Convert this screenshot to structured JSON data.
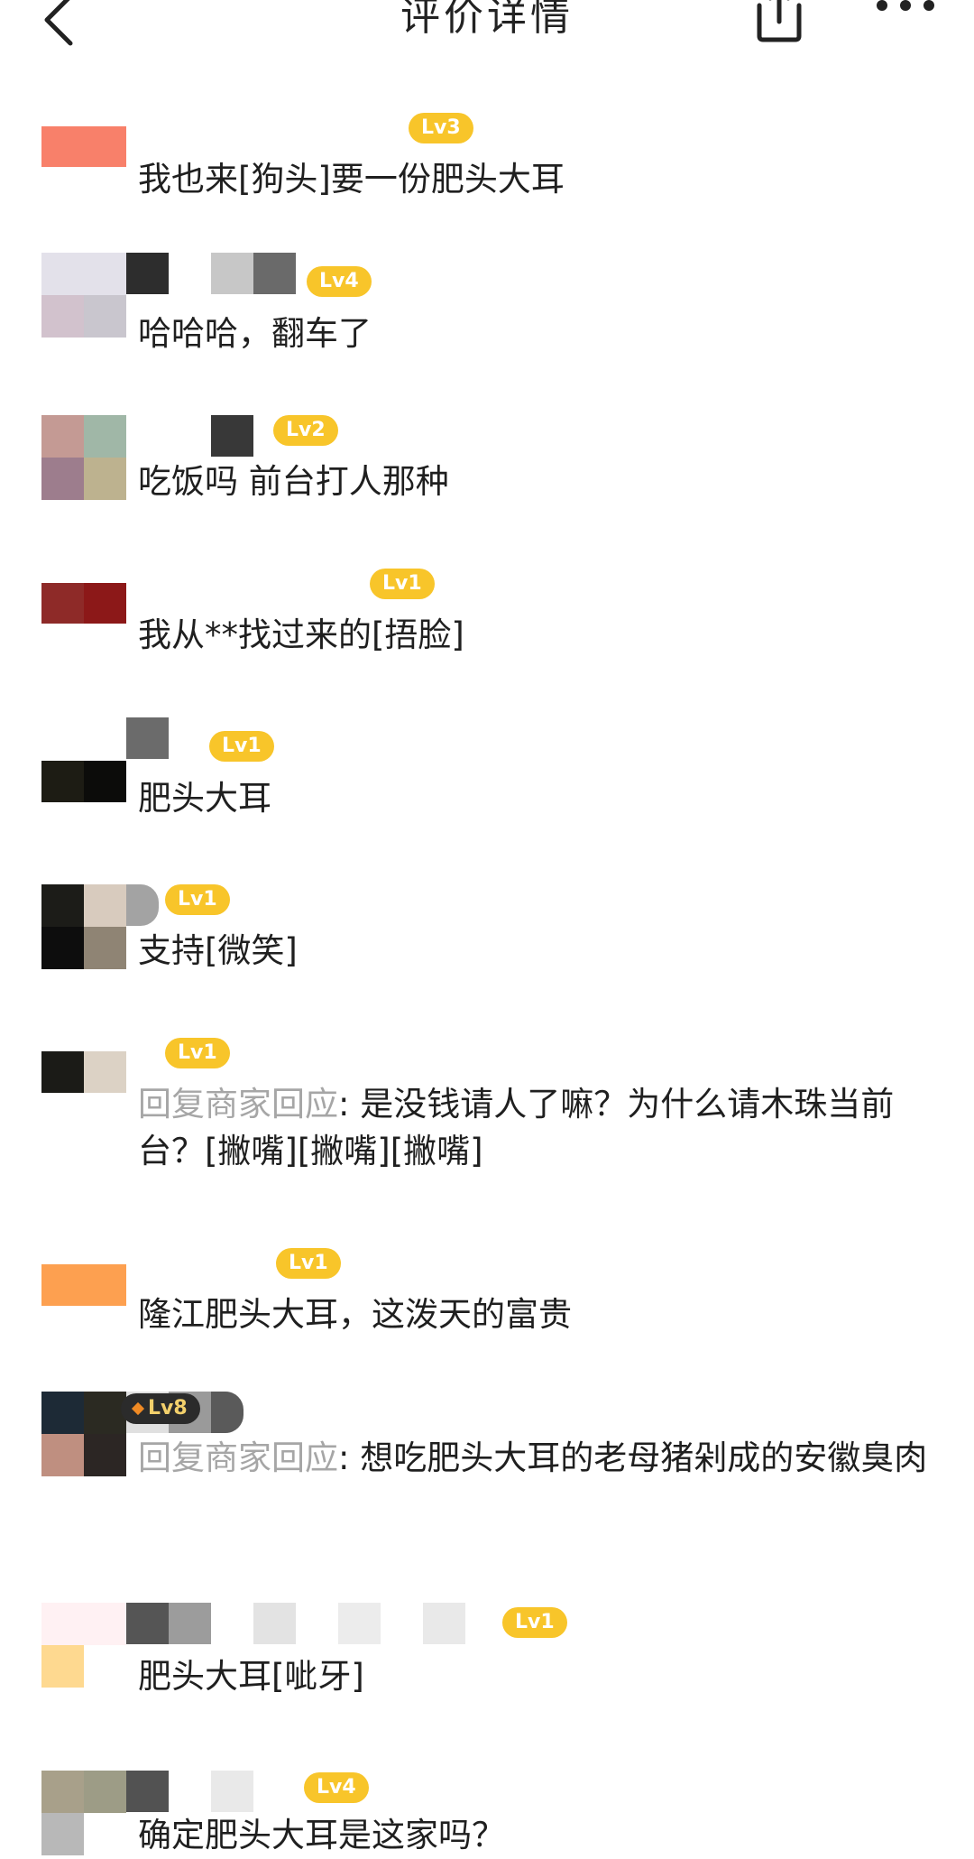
{
  "header": {
    "title": "评价详情",
    "back_icon": "chevron-left-icon",
    "share_icon": "share-icon",
    "more_icon": "more-dots-icon"
  },
  "comments": [
    {
      "level": "Lv3",
      "text": "我也来[狗头]要一份肥头大耳"
    },
    {
      "level": "Lv4",
      "text": "哈哈哈，翻车了"
    },
    {
      "level": "Lv2",
      "text": "吃饭吗 前台打人那种"
    },
    {
      "level": "Lv1",
      "text": "我从**找过来的[捂脸]"
    },
    {
      "level": "Lv1",
      "text": "肥头大耳"
    },
    {
      "level": "Lv1",
      "text": "支持[微笑]"
    },
    {
      "level": "Lv1",
      "reply_prefix": "回复商家回应",
      "text": ": 是没钱请人了嘛？为什么请木珠当前台？[撇嘴][撇嘴][撇嘴]"
    },
    {
      "level": "Lv1",
      "text": "隆江肥头大耳，这泼天的富贵"
    },
    {
      "level": "Lv8",
      "reply_prefix": "回复商家回应",
      "text": ": 想吃肥头大耳的老母猪剁成的安徽臭肉"
    },
    {
      "level": "Lv1",
      "text": "肥头大耳[呲牙]"
    },
    {
      "level": "Lv4",
      "text": "确定肥头大耳是这家吗？"
    }
  ],
  "colors": {
    "badge": "#f8c52a",
    "badge_dark": "#2b2b2b",
    "reply_prefix": "#a6a6a6",
    "text": "#1f1f1f"
  }
}
